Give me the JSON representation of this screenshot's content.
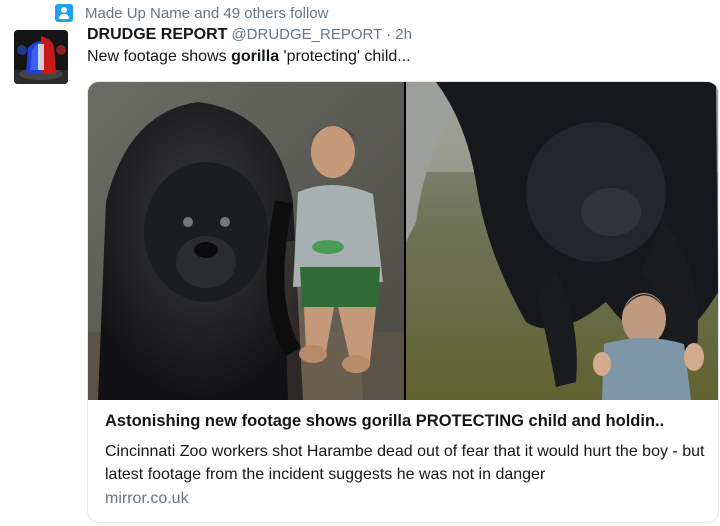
{
  "social_context": {
    "icon": "person-icon",
    "text": "Made Up Name and 49 others follow"
  },
  "tweet": {
    "author_name": "DRUDGE REPORT",
    "handle": "@DRUDGE_REPORT",
    "separator": "·",
    "time": "2h",
    "text_before": "New footage shows ",
    "text_bold": "gorilla",
    "text_after": " 'protecting' child..."
  },
  "card": {
    "title_before": "Astonishing new footage shows gorilla ",
    "title_bold": "PROTECTING",
    "title_after": " child and holdin..",
    "description": "Cincinnati Zoo workers shot Harambe dead out of fear that it would hurt the boy - but latest footage from the incident suggests he was not in danger",
    "domain": "mirror.co.uk"
  },
  "colors": {
    "accent": "#1da1f2",
    "secondary_text": "#657786",
    "primary_text": "#14171a",
    "card_border": "#e1e8ed"
  }
}
